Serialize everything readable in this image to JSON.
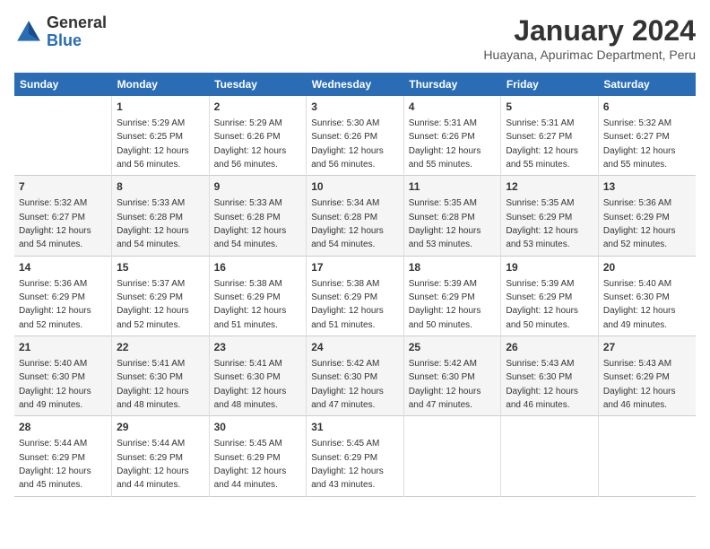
{
  "header": {
    "logo_general": "General",
    "logo_blue": "Blue",
    "title": "January 2024",
    "location": "Huayana, Apurimac Department, Peru"
  },
  "days_of_week": [
    "Sunday",
    "Monday",
    "Tuesday",
    "Wednesday",
    "Thursday",
    "Friday",
    "Saturday"
  ],
  "weeks": [
    [
      {
        "num": "",
        "info": ""
      },
      {
        "num": "1",
        "info": "Sunrise: 5:29 AM\nSunset: 6:25 PM\nDaylight: 12 hours\nand 56 minutes."
      },
      {
        "num": "2",
        "info": "Sunrise: 5:29 AM\nSunset: 6:26 PM\nDaylight: 12 hours\nand 56 minutes."
      },
      {
        "num": "3",
        "info": "Sunrise: 5:30 AM\nSunset: 6:26 PM\nDaylight: 12 hours\nand 56 minutes."
      },
      {
        "num": "4",
        "info": "Sunrise: 5:31 AM\nSunset: 6:26 PM\nDaylight: 12 hours\nand 55 minutes."
      },
      {
        "num": "5",
        "info": "Sunrise: 5:31 AM\nSunset: 6:27 PM\nDaylight: 12 hours\nand 55 minutes."
      },
      {
        "num": "6",
        "info": "Sunrise: 5:32 AM\nSunset: 6:27 PM\nDaylight: 12 hours\nand 55 minutes."
      }
    ],
    [
      {
        "num": "7",
        "info": "Sunrise: 5:32 AM\nSunset: 6:27 PM\nDaylight: 12 hours\nand 54 minutes."
      },
      {
        "num": "8",
        "info": "Sunrise: 5:33 AM\nSunset: 6:28 PM\nDaylight: 12 hours\nand 54 minutes."
      },
      {
        "num": "9",
        "info": "Sunrise: 5:33 AM\nSunset: 6:28 PM\nDaylight: 12 hours\nand 54 minutes."
      },
      {
        "num": "10",
        "info": "Sunrise: 5:34 AM\nSunset: 6:28 PM\nDaylight: 12 hours\nand 54 minutes."
      },
      {
        "num": "11",
        "info": "Sunrise: 5:35 AM\nSunset: 6:28 PM\nDaylight: 12 hours\nand 53 minutes."
      },
      {
        "num": "12",
        "info": "Sunrise: 5:35 AM\nSunset: 6:29 PM\nDaylight: 12 hours\nand 53 minutes."
      },
      {
        "num": "13",
        "info": "Sunrise: 5:36 AM\nSunset: 6:29 PM\nDaylight: 12 hours\nand 52 minutes."
      }
    ],
    [
      {
        "num": "14",
        "info": "Sunrise: 5:36 AM\nSunset: 6:29 PM\nDaylight: 12 hours\nand 52 minutes."
      },
      {
        "num": "15",
        "info": "Sunrise: 5:37 AM\nSunset: 6:29 PM\nDaylight: 12 hours\nand 52 minutes."
      },
      {
        "num": "16",
        "info": "Sunrise: 5:38 AM\nSunset: 6:29 PM\nDaylight: 12 hours\nand 51 minutes."
      },
      {
        "num": "17",
        "info": "Sunrise: 5:38 AM\nSunset: 6:29 PM\nDaylight: 12 hours\nand 51 minutes."
      },
      {
        "num": "18",
        "info": "Sunrise: 5:39 AM\nSunset: 6:29 PM\nDaylight: 12 hours\nand 50 minutes."
      },
      {
        "num": "19",
        "info": "Sunrise: 5:39 AM\nSunset: 6:29 PM\nDaylight: 12 hours\nand 50 minutes."
      },
      {
        "num": "20",
        "info": "Sunrise: 5:40 AM\nSunset: 6:30 PM\nDaylight: 12 hours\nand 49 minutes."
      }
    ],
    [
      {
        "num": "21",
        "info": "Sunrise: 5:40 AM\nSunset: 6:30 PM\nDaylight: 12 hours\nand 49 minutes."
      },
      {
        "num": "22",
        "info": "Sunrise: 5:41 AM\nSunset: 6:30 PM\nDaylight: 12 hours\nand 48 minutes."
      },
      {
        "num": "23",
        "info": "Sunrise: 5:41 AM\nSunset: 6:30 PM\nDaylight: 12 hours\nand 48 minutes."
      },
      {
        "num": "24",
        "info": "Sunrise: 5:42 AM\nSunset: 6:30 PM\nDaylight: 12 hours\nand 47 minutes."
      },
      {
        "num": "25",
        "info": "Sunrise: 5:42 AM\nSunset: 6:30 PM\nDaylight: 12 hours\nand 47 minutes."
      },
      {
        "num": "26",
        "info": "Sunrise: 5:43 AM\nSunset: 6:30 PM\nDaylight: 12 hours\nand 46 minutes."
      },
      {
        "num": "27",
        "info": "Sunrise: 5:43 AM\nSunset: 6:29 PM\nDaylight: 12 hours\nand 46 minutes."
      }
    ],
    [
      {
        "num": "28",
        "info": "Sunrise: 5:44 AM\nSunset: 6:29 PM\nDaylight: 12 hours\nand 45 minutes."
      },
      {
        "num": "29",
        "info": "Sunrise: 5:44 AM\nSunset: 6:29 PM\nDaylight: 12 hours\nand 44 minutes."
      },
      {
        "num": "30",
        "info": "Sunrise: 5:45 AM\nSunset: 6:29 PM\nDaylight: 12 hours\nand 44 minutes."
      },
      {
        "num": "31",
        "info": "Sunrise: 5:45 AM\nSunset: 6:29 PM\nDaylight: 12 hours\nand 43 minutes."
      },
      {
        "num": "",
        "info": ""
      },
      {
        "num": "",
        "info": ""
      },
      {
        "num": "",
        "info": ""
      }
    ]
  ]
}
